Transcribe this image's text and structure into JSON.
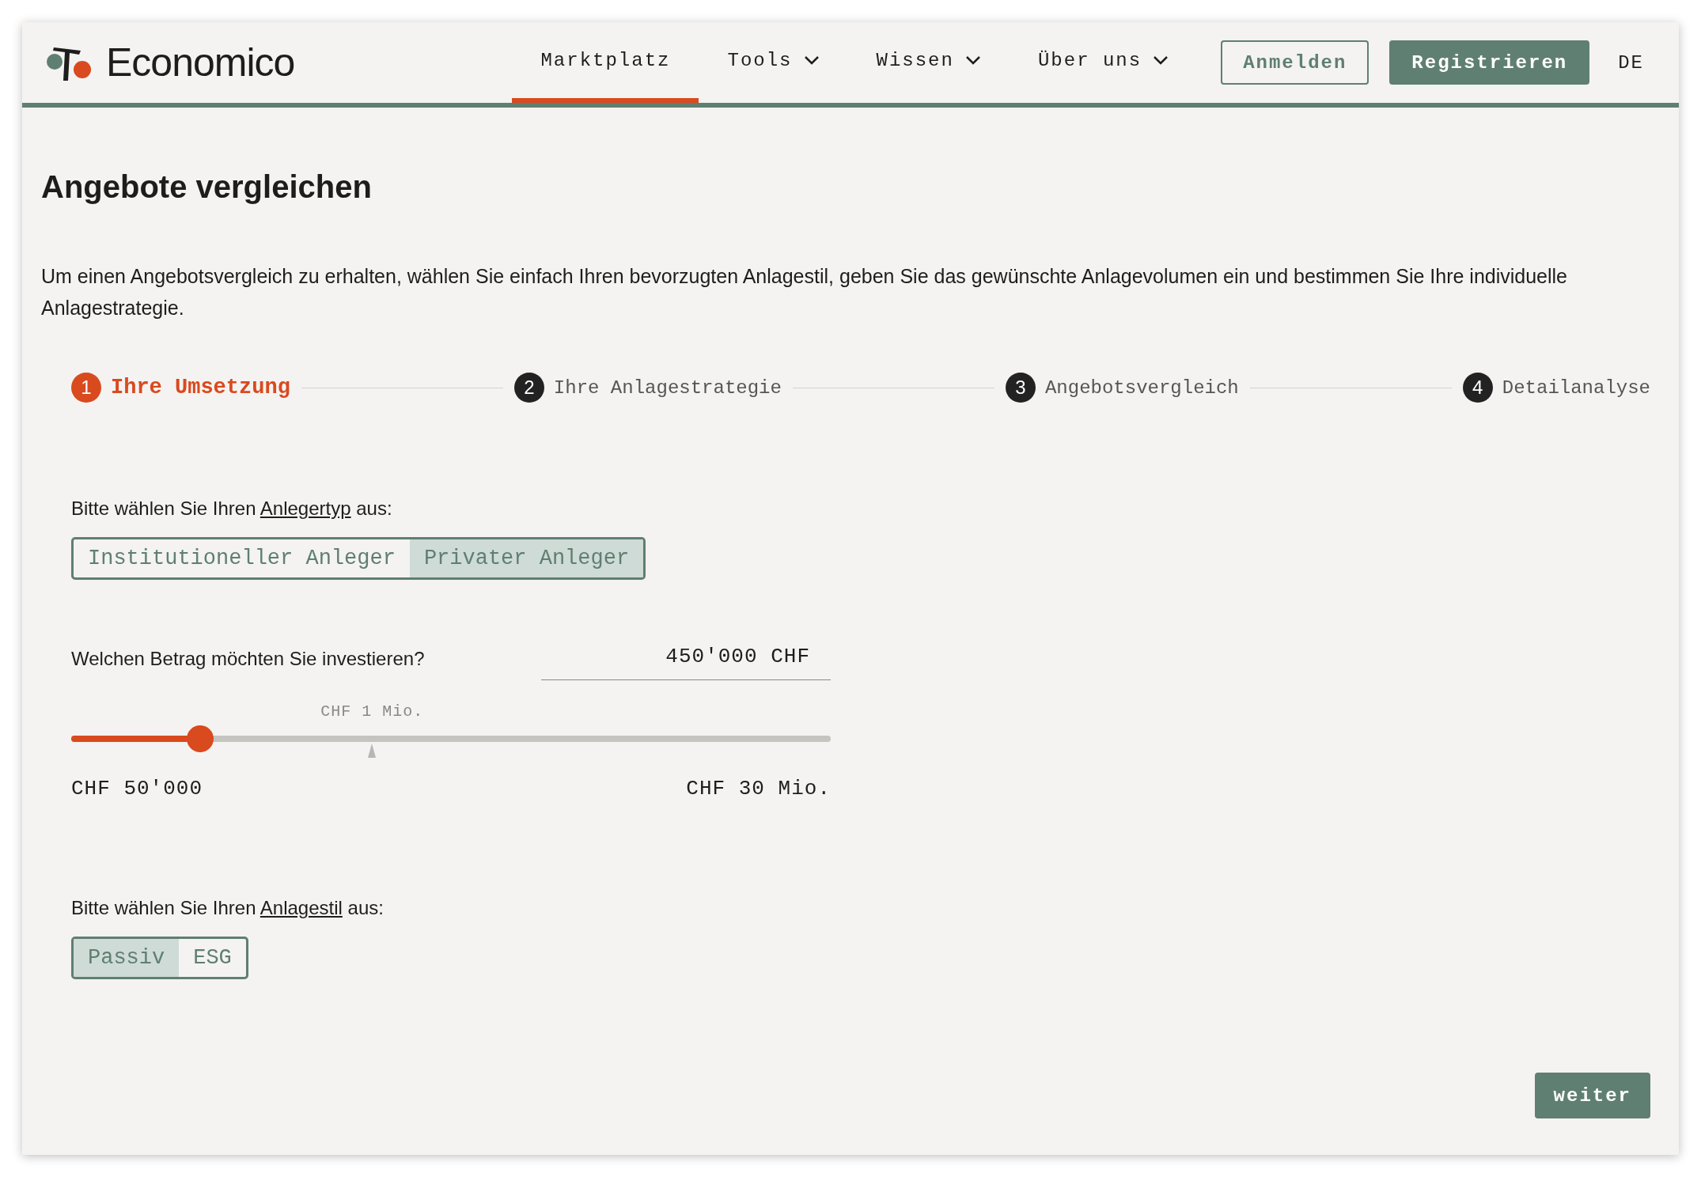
{
  "header": {
    "brand": "Economico",
    "nav": [
      {
        "label": "Marktplatz",
        "selected": true,
        "dropdown": false
      },
      {
        "label": "Tools",
        "selected": false,
        "dropdown": true
      },
      {
        "label": "Wissen",
        "selected": false,
        "dropdown": true
      },
      {
        "label": "Über uns",
        "selected": false,
        "dropdown": true
      }
    ],
    "login": "Anmelden",
    "register": "Registrieren",
    "language": "DE"
  },
  "title": "Angebote vergleichen",
  "intro": "Um einen Angebotsvergleich zu erhalten, wählen Sie einfach Ihren bevorzugten Anlagestil, geben Sie das gewünschte Anlagevolumen ein und bestimmen Sie Ihre individuelle Anlagestrategie.",
  "steps": [
    {
      "number": "1",
      "label": "Ihre Umsetzung",
      "selected": true
    },
    {
      "number": "2",
      "label": "Ihre Anlagestrategie",
      "selected": false
    },
    {
      "number": "3",
      "label": "Angebotsvergleich",
      "selected": false
    },
    {
      "number": "4",
      "label": "Detailanalyse",
      "selected": false
    }
  ],
  "investor_type": {
    "prompt_before": "Bitte wählen Sie Ihren ",
    "prompt_link": "Anlegertyp",
    "prompt_after": " aus:",
    "options": [
      {
        "label": "Institutioneller Anleger",
        "selected": false
      },
      {
        "label": "Privater Anleger",
        "selected": true
      }
    ]
  },
  "amount": {
    "question": "Welchen Betrag möchten Sie investieren?",
    "value": "450'000 CHF",
    "slider": {
      "level": 0.17,
      "marker_label": "CHF 1 Mio.",
      "min_label": "CHF 50'000",
      "max_label": "CHF 30 Mio."
    }
  },
  "style": {
    "prompt_before": "Bitte wählen Sie Ihren ",
    "prompt_link": "Anlagestil",
    "prompt_after": " aus:",
    "options": [
      {
        "label": "Passiv",
        "selected": true
      },
      {
        "label": "ESG",
        "selected": false
      }
    ]
  },
  "next_button": "weiter"
}
